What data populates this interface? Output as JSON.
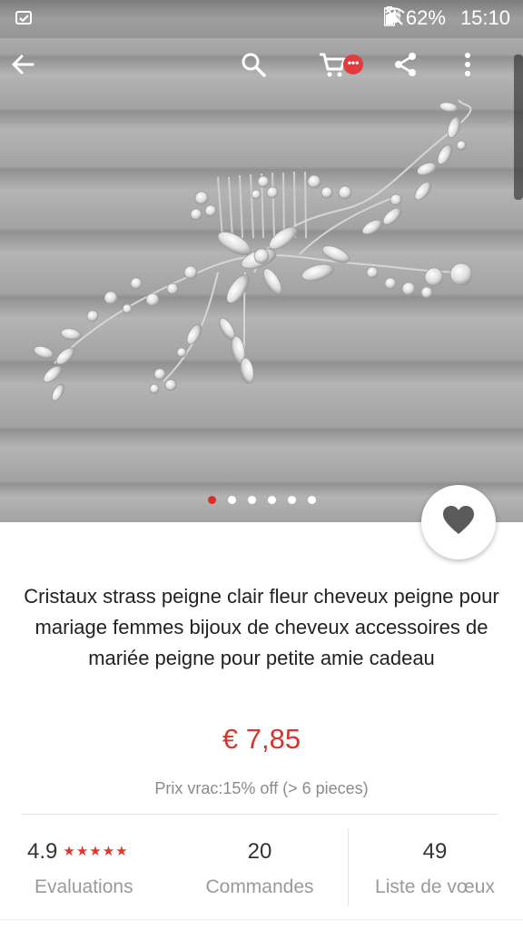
{
  "status_bar": {
    "battery_percent": "62%",
    "time": "15:10"
  },
  "toolbar": {
    "icons": [
      "back-arrow-icon",
      "search-icon",
      "cart-icon",
      "share-icon",
      "more-vert-icon"
    ],
    "cart_badge": "•••"
  },
  "carousel": {
    "total_images": 6,
    "active_index": 0
  },
  "product": {
    "title": "Cristaux strass peigne clair fleur cheveux peigne pour mariage femmes bijoux de cheveux accessoires de mariée peigne pour petite amie cadeau",
    "price": "€ 7,85",
    "bulk_price": "Prix vrac:15% off (> 6 pieces)"
  },
  "stats": {
    "rating": "4.9",
    "stars": "★★★★★",
    "rating_label": "Evaluations",
    "orders": "20",
    "orders_label": "Commandes",
    "wishlist": "49",
    "wishlist_label": "Liste de vœux"
  },
  "colors": {
    "accent_red": "#d8342c",
    "star_red": "#e3342f",
    "dot_active": "#e02b2b"
  }
}
